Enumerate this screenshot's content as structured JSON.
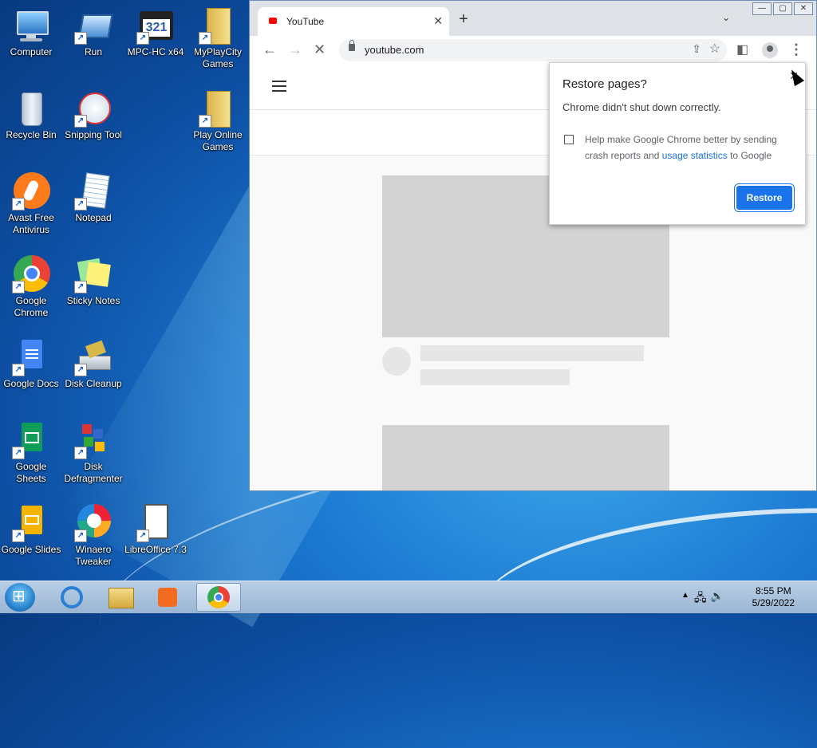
{
  "desktop": {
    "icons": [
      {
        "label": "Computer"
      },
      {
        "label": "Run"
      },
      {
        "label": "MPC-HC x64"
      },
      {
        "label": "MyPlayCity Games"
      },
      {
        "label": "Recycle Bin"
      },
      {
        "label": "Snipping Tool"
      },
      {
        "label": "Play Online Games"
      },
      {
        "label": "Avast Free Antivirus"
      },
      {
        "label": "Notepad"
      },
      {
        "label": "Google Chrome"
      },
      {
        "label": "Sticky Notes"
      },
      {
        "label": "Google Docs"
      },
      {
        "label": "Disk Cleanup"
      },
      {
        "label": "Google Sheets"
      },
      {
        "label": "Disk Defragmenter"
      },
      {
        "label": "Google Slides"
      },
      {
        "label": "Winaero Tweaker"
      },
      {
        "label": "LibreOffice 7.3"
      }
    ]
  },
  "browser": {
    "tab_title": "YouTube",
    "tab_close": "✕",
    "new_tab": "+",
    "tab_search": "⌄",
    "url": "youtube.com",
    "window_controls": {
      "minimize": "—",
      "maximize": "▢",
      "close": "✕"
    }
  },
  "popup": {
    "title": "Restore pages?",
    "message": "Chrome didn't shut down correctly.",
    "checkbox_text": "Help make Google Chrome better by sending crash reports and ",
    "checkbox_link": "usage statistics",
    "checkbox_text_end": " to Google",
    "restore_button": "Restore",
    "close": "✕"
  },
  "taskbar": {
    "time": "8:55 PM",
    "date": "5/29/2022"
  }
}
